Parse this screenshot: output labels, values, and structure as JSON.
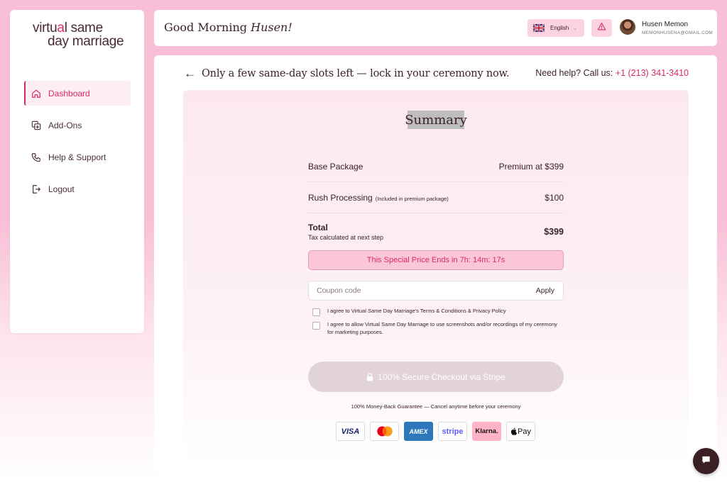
{
  "brand": {
    "line1_pre": "virtu",
    "line1_accent": "a",
    "line1_post": "l same",
    "line2": "day marriage"
  },
  "sidebar": {
    "items": [
      {
        "label": "Dashboard",
        "icon": "home-icon",
        "active": true
      },
      {
        "label": "Add-Ons",
        "icon": "add-ons-icon",
        "active": false
      },
      {
        "label": "Help & Support",
        "icon": "phone-icon",
        "active": false
      },
      {
        "label": "Logout",
        "icon": "logout-icon",
        "active": false
      }
    ]
  },
  "header": {
    "greeting": "Good Morning",
    "greeting_name": "Husen!",
    "language": "English",
    "user": {
      "name": "Husen Memon",
      "email": "MEMONHUSENA@GMAIL.COM"
    }
  },
  "main": {
    "slots_message": "Only a few same-day slots left — lock in your ceremony now.",
    "help_label": "Need help? Call us:",
    "help_phone": "+1 (213) 341-3410"
  },
  "summary": {
    "title": "Summary",
    "rows": [
      {
        "label": "Base Package",
        "note": "",
        "value": "Premium at $399"
      },
      {
        "label": "Rush Processing",
        "note": "(Included in premium package)",
        "value": "$100"
      }
    ],
    "total_label": "Total",
    "total_sub": "Tax calculated at next step",
    "total_value": "$399",
    "special_price": "This Special Price Ends in 7h: 14m: 17s",
    "coupon_placeholder": "Coupon code",
    "apply_label": "Apply",
    "agreements": [
      "I agree to Virtual Same Day Marriage's Terms & Conditions & Privacy Policy",
      "I agree to allow Virtual Same Day Marriage to use screenshots and/or recordings of my ceremony for marketing purposes."
    ],
    "checkout_label": "100% Secure Checkout via Stripe",
    "guarantee": "100% Money-Back Guarantee — Cancel anytime before your ceremony",
    "payments": [
      "VISA",
      "Mastercard",
      "AMEX",
      "stripe",
      "Klarna.",
      "Pay"
    ]
  },
  "colors": {
    "accent": "#d92b62",
    "pink_bg": "#f9bfd6",
    "dark": "#3b2326"
  }
}
